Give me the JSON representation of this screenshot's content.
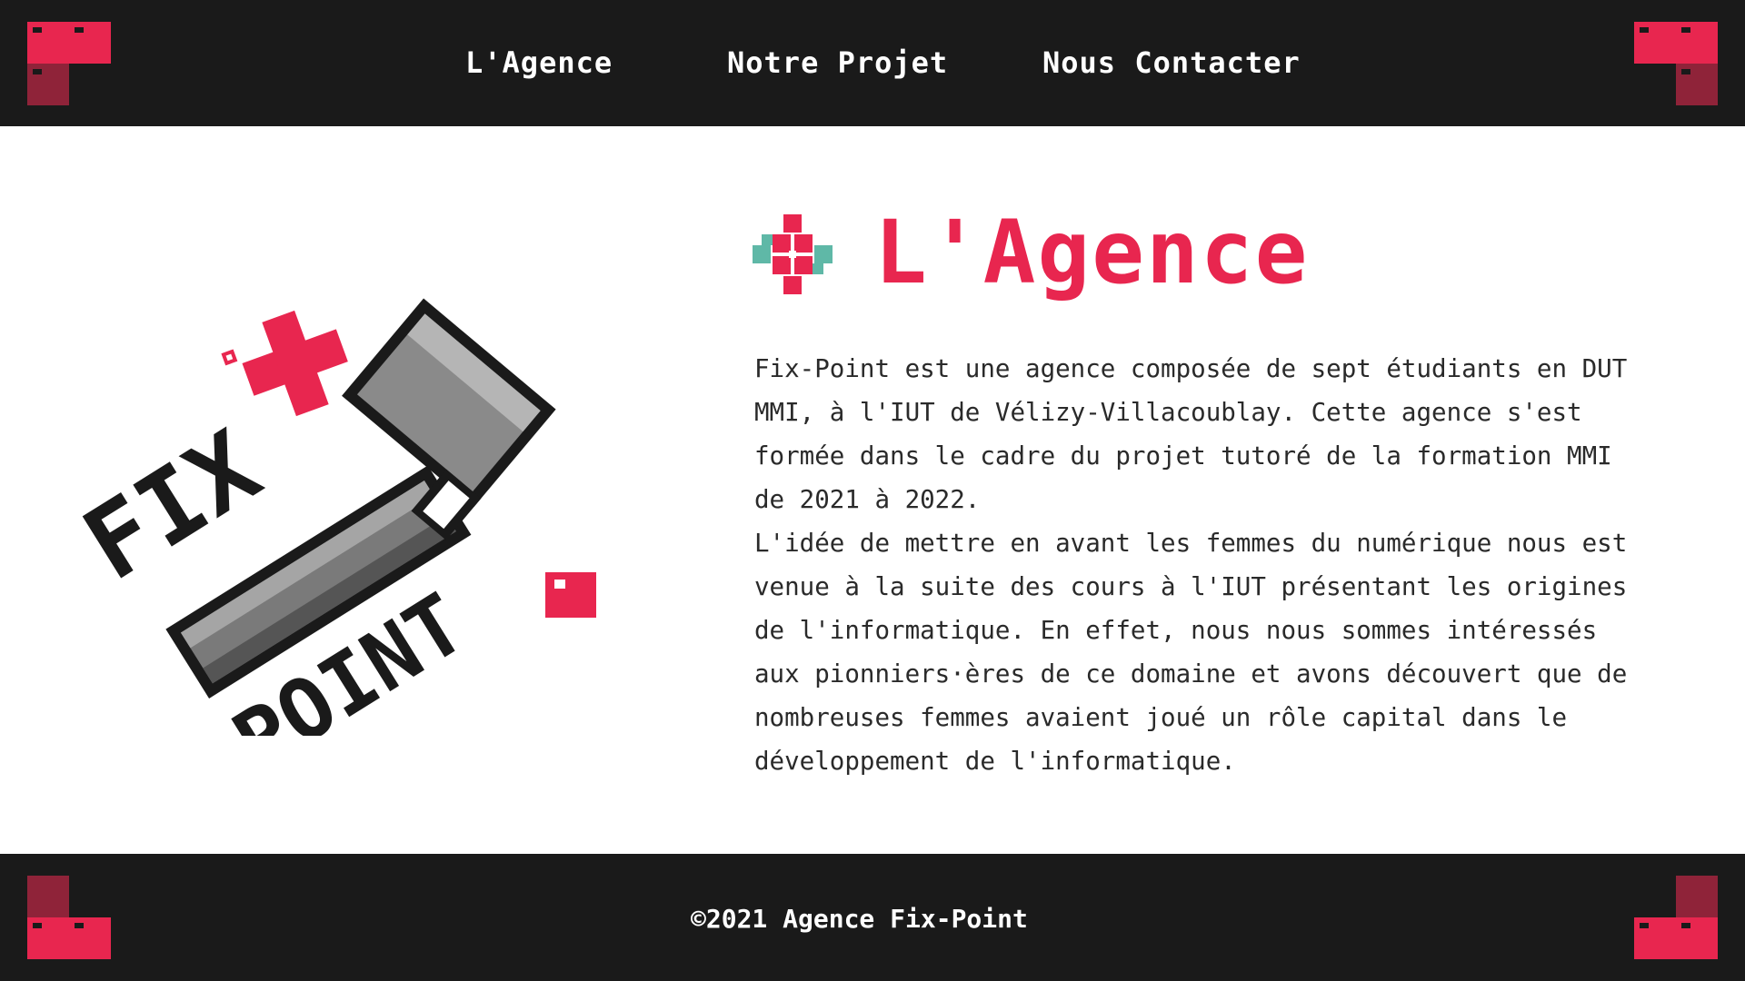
{
  "nav": {
    "items": [
      {
        "label": "L'Agence"
      },
      {
        "label": "Notre Projet"
      },
      {
        "label": "Nous Contacter"
      }
    ]
  },
  "logo": {
    "text_fix": "FIX",
    "text_point": "POINT"
  },
  "main": {
    "title": "L'Agence",
    "paragraphs": [
      "Fix-Point est une agence composée de sept étudiants en DUT MMI, à l'IUT de Vélizy-Villacoublay. Cette agence s'est formée dans le cadre du projet tutoré de la formation MMI de 2021 à 2022.",
      "L'idée de mettre en avant les femmes du numérique nous est venue à la suite des cours à l'IUT présentant les origines de l'informatique. En effet, nous nous sommes intéressés aux pionniers·ères de ce domaine et avons découvert que de nombreuses femmes avaient joué un rôle capital dans le développement de l'informatique."
    ]
  },
  "footer": {
    "copyright": "©2021 Agence Fix-Point"
  },
  "colors": {
    "accent": "#e8264f",
    "accent_dark": "#8f2339",
    "bar": "#1a1a1a",
    "teal": "#5fb8a7"
  },
  "icons": {
    "corner": "pixel-block-icon",
    "title": "pixel-flower-icon",
    "logo": "hammer-logo"
  }
}
